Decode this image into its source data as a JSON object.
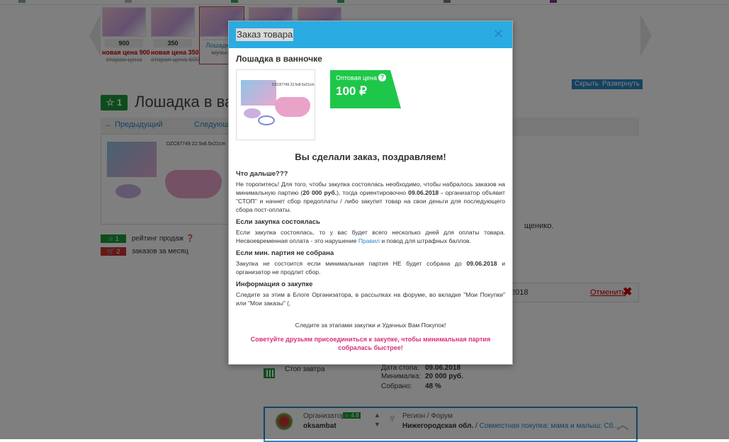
{
  "background": {
    "thumbs": [
      {
        "price": "900",
        "new_price": "новая цена 900",
        "old_price": "старая цена"
      },
      {
        "price": "350",
        "new_price": "новая цена 350",
        "old_price": "старая цена 600"
      },
      {
        "price": "",
        "new_price": "Лошадка...",
        "old_price": "музы..."
      }
    ],
    "hide_label": "Скрыть",
    "expand_label": "Развернуть",
    "rating_value": "1",
    "product_title": "Лошадка в ва",
    "prev_label": "Предыдущий",
    "next_label": "Следующий",
    "product_image_label": "DZC87749 22.5x8.5x21cm",
    "sales_rating_chip": "1",
    "sales_rating_label": "рейтинг продаж",
    "orders_chip": "2",
    "orders_label": "заказов за месяц",
    "right_text": "щенико.",
    "order_date": "2018",
    "cancel_label": "Отменить",
    "stop_label": "Стоп завтра",
    "stop_date_label": "Дата стопа:",
    "stop_date_value": "09.06.2018",
    "min_label": "Минималка:",
    "min_value": "20 000 руб.",
    "collected_label": "Собрано:",
    "collected_value": "48 %",
    "organizer_label": "Организатор",
    "organizer_rating": "4.8",
    "organizer_name": "oksambat",
    "region_label": "Регион / Форум",
    "region_value": "Нижегородская обл.",
    "forum_value": "Совместная покупка: мама и малыш: Сб..."
  },
  "modal": {
    "title": "Заказ товара",
    "product_title": "Лошадка в ванночке",
    "image_label": "DZC87749 22.5x8.5x21cm",
    "price_label": "Оптовая цена",
    "price_value": "100 ₽",
    "congrats": "Вы сделали заказ, поздравляем!",
    "what_next_title": "Что дальше???",
    "what_next_text_1": "Не торопитесь! Для того, чтобы закупка состоялась необходимо, чтобы набралось заказов на минимальную партию (",
    "what_next_min": "20 000 руб.",
    "what_next_text_2": "), тогда ориентировочно ",
    "what_next_date": "09.06.2018 -",
    "what_next_text_3": " организатор объявит \"СТОП\" и начнет сбор предоплаты / либо закупит товар на свои деньги для последующего сбора пост-оплаты.",
    "success_title": "Если закупка состоялась",
    "success_text_1": "Если закупка состоялась, то у вас будет всего несколько дней для оплаты товара. Несвоевременная оплата - это нарушение ",
    "success_link": "Правил",
    "success_text_2": " и повод для штрафных баллов.",
    "fail_title": "Если мин. партия не собрана",
    "fail_text_1": "Закупка не состоится если минимальная партия НЕ будет собрана до ",
    "fail_date": "09.06.2018",
    "fail_text_2": " и организатор не продлит сбор.",
    "info_title": "Информация о закупке",
    "info_text": "Следите за этим в Блоге Организатора, в рассылках на форуме, во вкладке \"Мои Покупки\" или \"Мои заказы\" (.",
    "follow_text": "Следите за этапами закупки и Удачных Вам Покупок!",
    "advice_text": "Советуйте друзьям присоединиться к закупке, чтобы минимальная партия собралась быстрее!",
    "close_symbol": "✕"
  },
  "colors": {
    "header_blue": "#2aabe2",
    "price_green": "#1ec74a",
    "advice_pink": "#d6307a",
    "overlay": "rgba(0,0,0,0.5)"
  }
}
